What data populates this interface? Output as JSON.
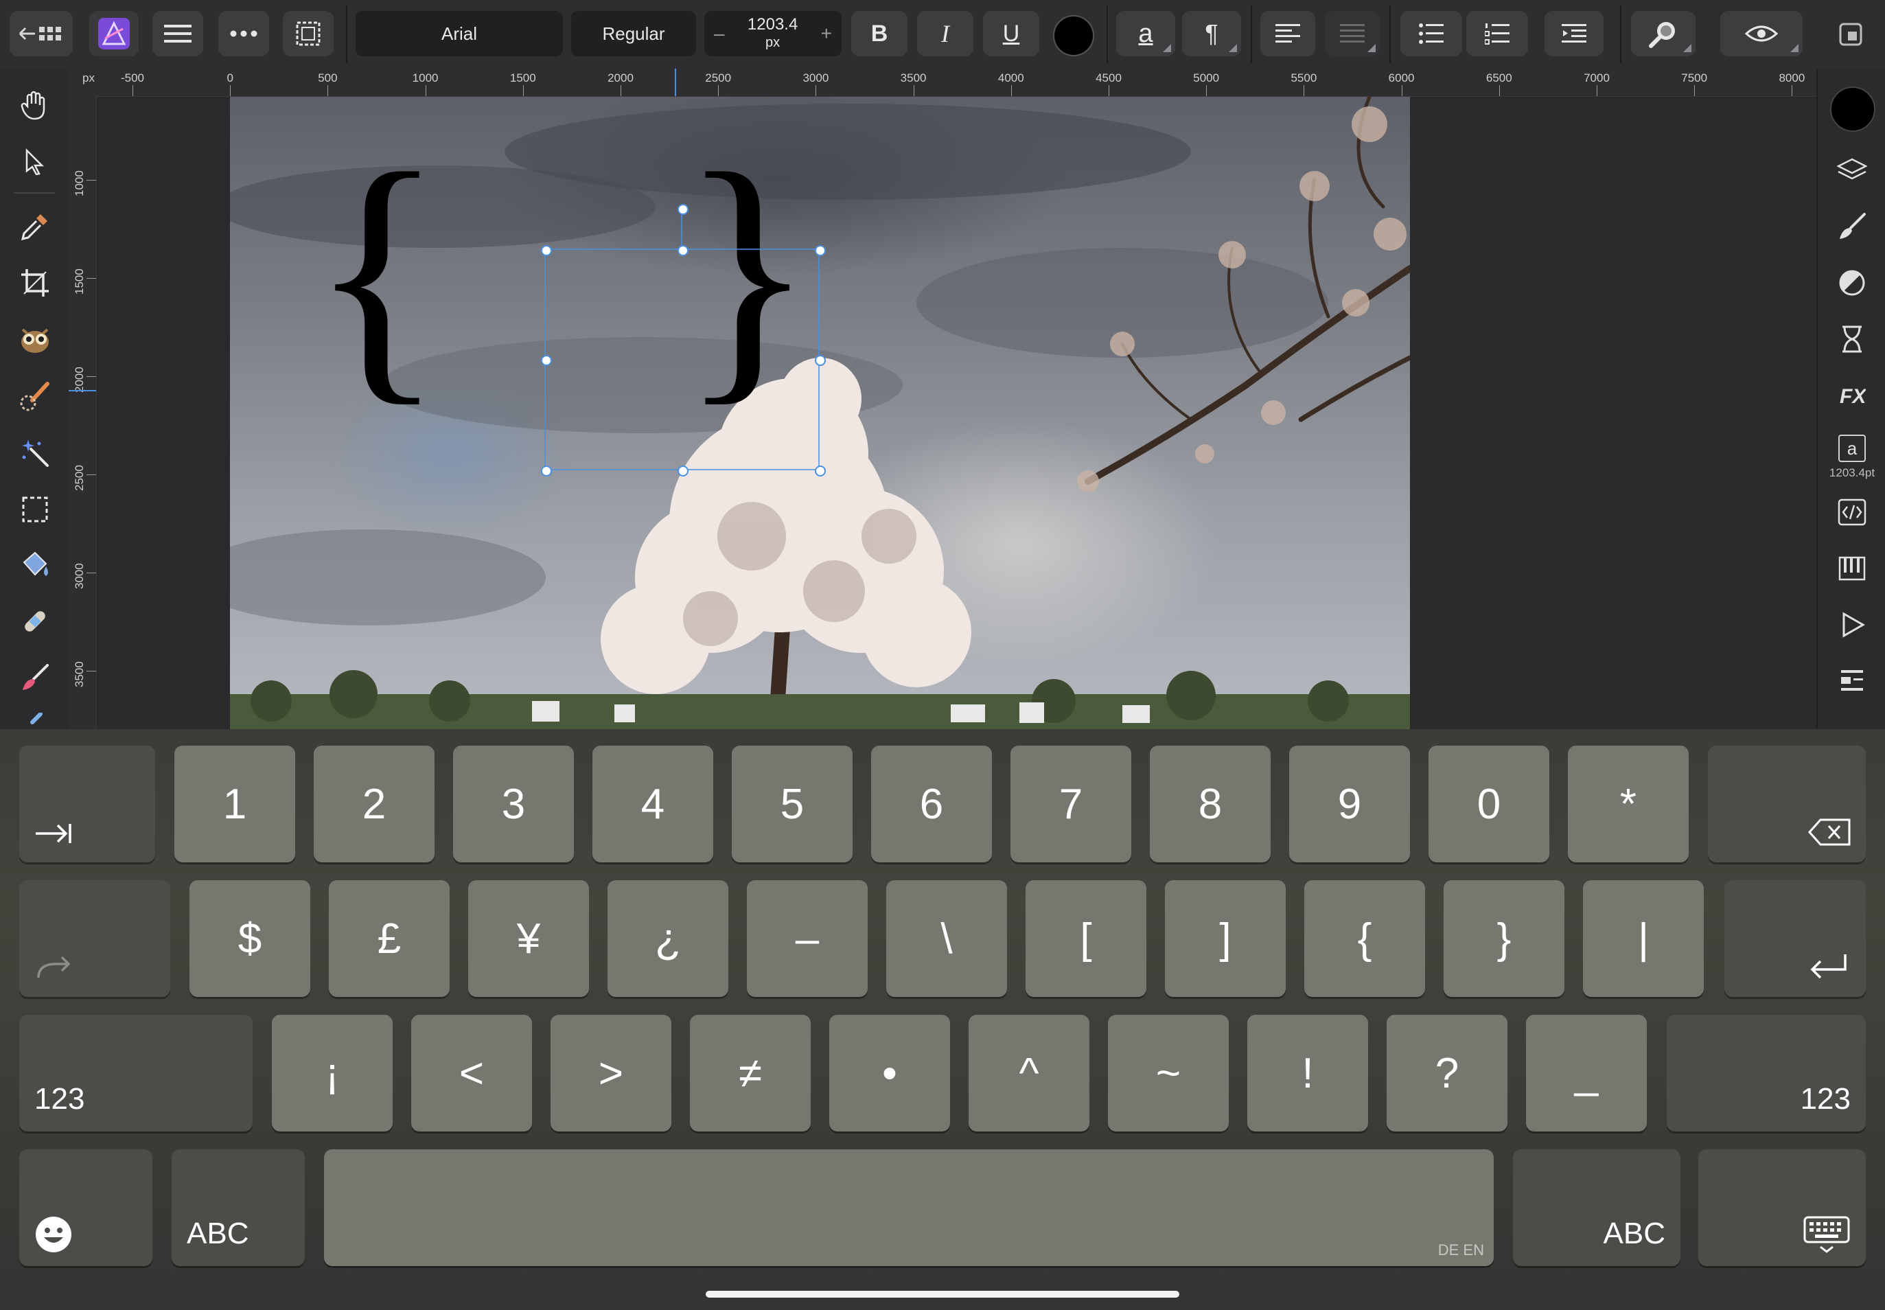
{
  "toolbar": {
    "font_family": "Arial",
    "font_style": "Regular",
    "font_size_value": "1203.4",
    "font_size_unit": "px",
    "minus_label": "–",
    "plus_label": "+",
    "bold_label": "B",
    "italic_label": "I",
    "underline_label": "U",
    "char_format_label": "a",
    "paragraph_label": "¶",
    "accent_color": "#000000",
    "app_icon_color": "#7a4bd6"
  },
  "ruler": {
    "unit": "px",
    "top_labels": [
      "-500",
      "0",
      "500",
      "1000",
      "1500",
      "2000",
      "2500",
      "3000",
      "3500",
      "4000",
      "4500",
      "5000",
      "5500",
      "6000",
      "6500",
      "7000",
      "7500",
      "8000"
    ],
    "left_labels": [
      "1000",
      "1500",
      "2000",
      "2500",
      "3000",
      "3500"
    ]
  },
  "canvas": {
    "text_content": "{ }",
    "text_color": "#000000",
    "selection_color": "#4a90e2"
  },
  "right_panel": {
    "text_size_label": "1203.4pt",
    "text_style_glyph": "a",
    "color_swatch": "#000000"
  },
  "keyboard": {
    "row1": [
      "1",
      "2",
      "3",
      "4",
      "5",
      "6",
      "7",
      "8",
      "9",
      "0",
      "*"
    ],
    "row2": [
      "$",
      "£",
      "¥",
      "¿",
      "–",
      "\\",
      "[",
      "]",
      "{",
      "}",
      "|"
    ],
    "row3": [
      "¡",
      "<",
      ">",
      "≠",
      "•",
      "^",
      "~",
      "!",
      "?",
      "_"
    ],
    "shift_label_left": "123",
    "shift_label_right": "123",
    "abc_left": "ABC",
    "abc_right": "ABC",
    "language_hint": "DE EN"
  }
}
